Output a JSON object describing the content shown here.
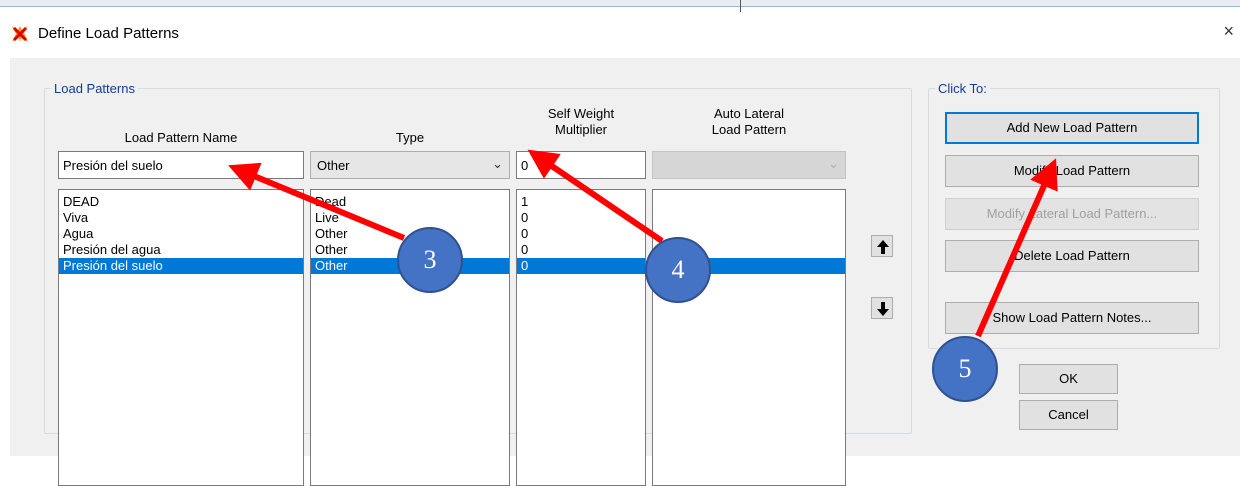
{
  "window": {
    "title": "Define Load Patterns",
    "close_glyph": "×"
  },
  "load_patterns": {
    "group_title": "Load Patterns",
    "headers": {
      "name": "Load Pattern Name",
      "type": "Type",
      "multiplier_line1": "Self Weight",
      "multiplier_line2": "Multiplier",
      "auto_line1": "Auto Lateral",
      "auto_line2": "Load Pattern"
    },
    "edit_row": {
      "name": "Presión del suelo",
      "type": "Other",
      "multiplier": "0",
      "auto_lateral": ""
    },
    "names": [
      "DEAD",
      "Viva",
      "Agua",
      "Presión del agua",
      "Presión del suelo"
    ],
    "types": [
      "Dead",
      "Live",
      "Other",
      "Other",
      "Other"
    ],
    "multipliers": [
      "1",
      "0",
      "0",
      "0",
      "0"
    ],
    "selected_index": 4
  },
  "click_to": {
    "group_title": "Click To:",
    "add": "Add New Load Pattern",
    "modify": "Modify Load Pattern",
    "modify_lateral": "Modify Lateral Load Pattern...",
    "delete": "Delete Load Pattern",
    "notes": "Show Load Pattern Notes..."
  },
  "ok": "OK",
  "cancel": "Cancel",
  "callouts": [
    "3",
    "4",
    "5"
  ],
  "icons": {
    "app": "sap2000-icon",
    "up": "move-up-icon",
    "down": "move-down-icon"
  },
  "colors": {
    "accent": "#0078d7",
    "group_title": "#0f3c96",
    "callout": "#4472c4",
    "arrow": "#ff0000"
  }
}
